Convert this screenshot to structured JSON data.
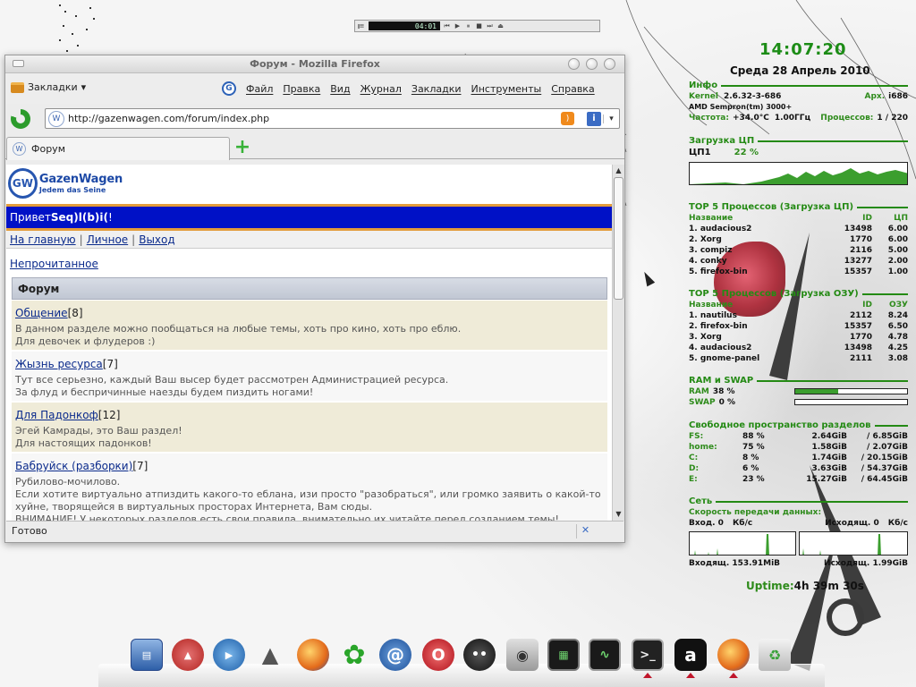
{
  "player": {
    "time": "04:01"
  },
  "window": {
    "title": "Форум - Mozilla Firefox",
    "bookmarks_label": "Закладки",
    "menus": [
      "Файл",
      "Правка",
      "Вид",
      "Журнал",
      "Закладки",
      "Инструменты",
      "Справка"
    ],
    "url": "http://gazenwagen.com/forum/index.php",
    "tab_label": "Форум",
    "status": "Готово"
  },
  "site": {
    "logo_name": "GazenWagen",
    "logo_slogan": "Jedem das Seine",
    "greeting": "Привет ",
    "username": "Seq)l(b)i(",
    "greeting_end": "!",
    "nav_links": [
      "На главную",
      "Личное",
      "Выход"
    ],
    "unread_link": "Непрочитанное",
    "forum_header": "Форум",
    "sections": [
      {
        "title": "Общение",
        "count": " [8]",
        "desc": [
          "В данном разделе можно пообщаться на любые темы, хоть про кино, хоть про еблю.",
          "Для девочек и флудеров :)"
        ]
      },
      {
        "title": "Жызнь ресурса",
        "count": " [7]",
        "desc": [
          "Тут все серьезно, каждый Ваш высер будет рассмотрен Администрацией ресурса.",
          "За флуд и беспричинные наезды будем пиздить ногами!"
        ]
      },
      {
        "title": "Для Падонкоф",
        "count": " [12]",
        "desc": [
          "Эгей Камрады, это Ваш раздел!",
          "Для настоящих падонков!"
        ]
      },
      {
        "title": "Бабруйск (разборки)",
        "count": " [7]",
        "desc": [
          "Рубилово-мочилово.",
          "Если хотите виртуально атпиздить какого-то еблана, изи просто \"разобраться\", или громко заявить о какой-то",
          "хуйне, творящейся в виртуальных просторах Интернета, Вам сюды.",
          "ВНИМАНИЕ! У некоторых разделов есть свои правила, внимательно их читайте перед созданием темы!"
        ]
      }
    ]
  },
  "conky": {
    "time": "14:07:20",
    "date": "Среда 28 Апрель 2010",
    "info_title": "Инфо",
    "kernel_label": "Kernel",
    "kernel": "2.6.32-3-686",
    "arch_label": "Арх.",
    "arch": "i686",
    "cpu_name": "AMD Sempron(tm) 3000+",
    "freq_label": "Частота:",
    "temp": "+34.0°C",
    "freq": "1.00ГГц",
    "procs_label": "Процессов:",
    "procs": "1 / 220",
    "cpu_title": "Загрузка ЦП",
    "cpu_label": "ЦП1",
    "cpu_pct": "22 %",
    "top_cpu_title": "TOP 5 Процессов (Загрузка ЦП)",
    "top_cpu_cols": [
      "Название",
      "ID",
      "ЦП"
    ],
    "top_cpu": [
      [
        "1. audacious2",
        "13498",
        "6.00"
      ],
      [
        "2. Xorg",
        "1770",
        "6.00"
      ],
      [
        "3. compiz",
        "2116",
        "5.00"
      ],
      [
        "4. conky",
        "13277",
        "2.00"
      ],
      [
        "5. firefox-bin",
        "15357",
        "1.00"
      ]
    ],
    "top_mem_title": "TOP 5 Процессов (Загрузка ОЗУ)",
    "top_mem_cols": [
      "Название",
      "ID",
      "ОЗУ"
    ],
    "top_mem": [
      [
        "1. nautilus",
        "2112",
        "8.24"
      ],
      [
        "2. firefox-bin",
        "15357",
        "6.50"
      ],
      [
        "3. Xorg",
        "1770",
        "4.78"
      ],
      [
        "4. audacious2",
        "13498",
        "4.25"
      ],
      [
        "5. gnome-panel",
        "2111",
        "3.08"
      ]
    ],
    "ram_title": "RAM и SWAP",
    "ram_label": "RAM",
    "ram_pct": "38 %",
    "ram_value": 0.38,
    "swap_label": "SWAP",
    "swap_pct": "0 %",
    "swap_value": 0.0,
    "disk_title": "Свободное пространство разделов",
    "disks": [
      [
        "FS:",
        "88 %",
        "2.64GiB",
        "/ 6.85GiB"
      ],
      [
        "home:",
        "75 %",
        "1.58GiB",
        "/ 2.07GiB"
      ],
      [
        "C:",
        "8 %",
        "1.74GiB",
        "/ 20.15GiB"
      ],
      [
        "D:",
        "6 %",
        "3.63GiB",
        "/ 54.37GiB"
      ],
      [
        "E:",
        "23 %",
        "15.27GiB",
        "/ 64.45GiB"
      ]
    ],
    "net_title": "Сеть",
    "net_speed_title": "Скорость передачи данных:",
    "down_label": "Вход. 0",
    "down_unit": "Кб/с",
    "up_label": "Исходящ. 0",
    "up_unit": "Кб/с",
    "down_total": "Входящ. 153.91MiB",
    "up_total": "Исходящ. 1.99GiB",
    "uptime_label": "Uptime:",
    "uptime": "4h 39m 30s"
  },
  "dock": [
    "system-icon",
    "firewall-icon",
    "media-player-icon",
    "vlc-icon",
    "firefox-icon",
    "icq-icon",
    "email-icon",
    "opera-icon",
    "pidgin-icon",
    "camera-icon",
    "system-monitor-icon",
    "activity-monitor-icon",
    "terminal-icon",
    "audacious-icon",
    "firefox-icon",
    "trash-icon"
  ],
  "colors": {
    "accent_green": "#248a14",
    "forum_blue": "#0011c6",
    "forum_orange": "#e39c3a"
  }
}
